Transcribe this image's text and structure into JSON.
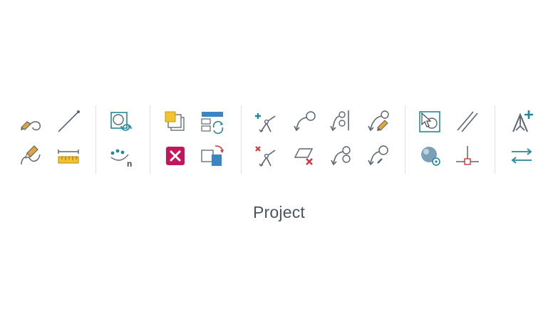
{
  "ribbon": {
    "group_label": "Project",
    "colors": {
      "stroke": "#5b6670",
      "teal": "#1f8a9b",
      "pencil": "#e3a43a",
      "red": "#d8333d",
      "magenta": "#c2185b",
      "yellow": "#f2c230",
      "blue": "#3a86c4"
    },
    "buttons": [
      {
        "name": "sketch-curve-icon"
      },
      {
        "name": "draw-line-icon"
      },
      {
        "name": "edit-sketch-curve-icon"
      },
      {
        "name": "ruler-measure-icon"
      },
      {
        "name": "frame-refresh-icon"
      },
      {
        "name": "point-series-n-icon"
      },
      {
        "name": "copy-stack-icon"
      },
      {
        "name": "layout-refresh-icon"
      },
      {
        "name": "delete-x-icon"
      },
      {
        "name": "swap-frames-icon"
      },
      {
        "name": "add-branch-icon"
      },
      {
        "name": "node-link-icon"
      },
      {
        "name": "node-split-icon"
      },
      {
        "name": "node-edit-icon"
      },
      {
        "name": "remove-branch-icon"
      },
      {
        "name": "delete-plane-icon"
      },
      {
        "name": "node-join-icon"
      },
      {
        "name": "node-arrow-icon"
      },
      {
        "name": "select-cursor-icon"
      },
      {
        "name": "parallel-lines-icon"
      },
      {
        "name": "sphere-target-icon"
      },
      {
        "name": "perpendicular-node-icon"
      },
      {
        "name": "add-vertex-icon"
      },
      {
        "name": "swap-arrows-icon"
      }
    ]
  }
}
